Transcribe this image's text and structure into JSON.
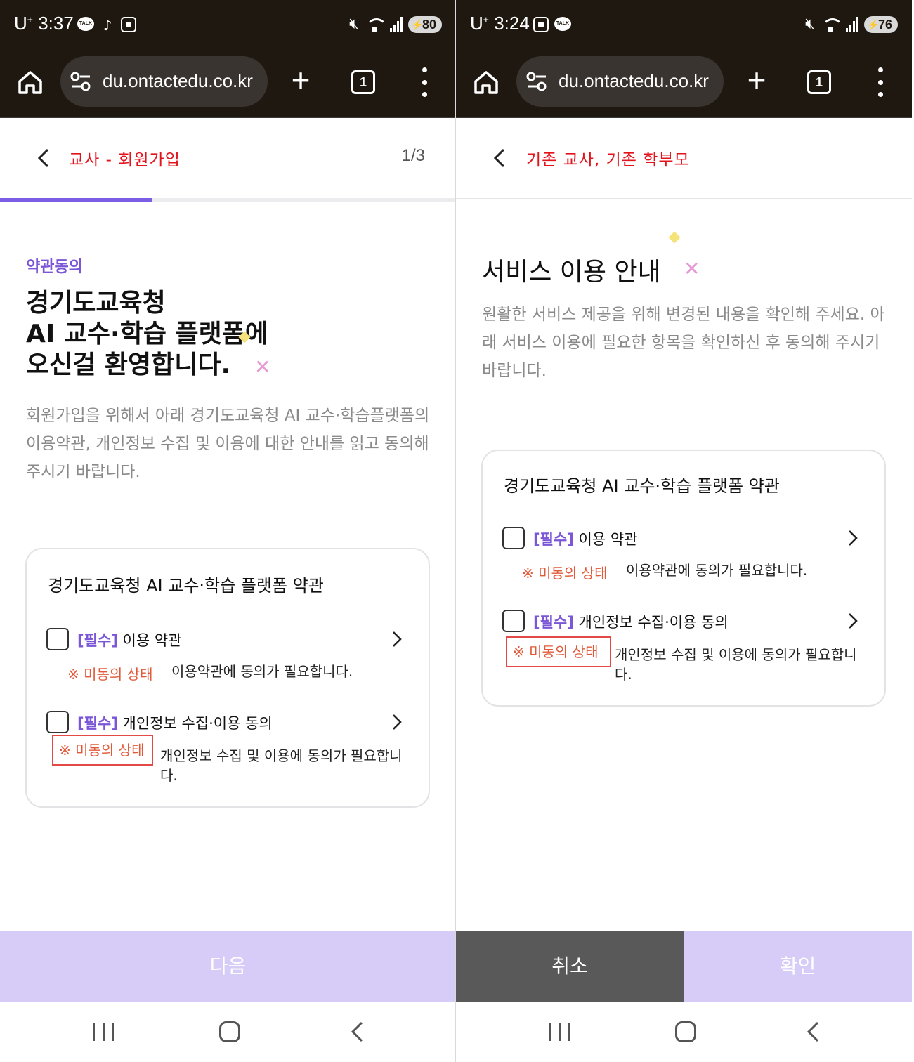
{
  "status_left": {
    "carrier": "U",
    "carrier_sup": "+",
    "time": "3:37",
    "battery": "80"
  },
  "status_right": {
    "carrier": "U",
    "carrier_sup": "+",
    "time": "3:24",
    "battery": "76"
  },
  "browser": {
    "url": "du.ontactedu.co.kr",
    "tab_count": "1"
  },
  "left": {
    "header_title": "교사 - 회원가입",
    "step": "1/3",
    "progress": 0.333,
    "eyebrow": "약관동의",
    "headline_line1": "경기도교육청",
    "headline_line2": "AI 교수·학습 플랫폼에",
    "headline_line3_a": "오신걸 ",
    "headline_line3_b": "환영합니다.",
    "description": "회원가입을 위해서 아래 경기도교육청 AI 교수·학습플랫폼의 이용약관, 개인정보 수집 및 이용에 대한 안내를 읽고 동의해 주시기 바랍니다.",
    "next_button": "다음"
  },
  "right": {
    "header_title": "기존 교사, 기존 학부모",
    "title": "서비스 이용 안내",
    "description": "원활한 서비스 제공을 위해 변경된 내용을 확인해 주세요. 아래 서비스 이용에 필요한 항목을 확인하신 후 동의해 주시기 바랍니다.",
    "cancel_button": "취소",
    "confirm_button": "확인"
  },
  "terms": {
    "card_title": "경기도교육청 AI 교수·학습 플랫폼 약관",
    "items": [
      {
        "required_tag": "[필수]",
        "label": " 이용 약관",
        "status": "※ 미동의 상태",
        "status_desc": "이용약관에 동의가 필요합니다.",
        "checked": false
      },
      {
        "required_tag": "[필수]",
        "label": " 개인정보 수집·이용 동의",
        "status": "※ 미동의 상태",
        "status_desc": "개인정보 수집 및 이용에 동의가 필요합니다.",
        "checked": false
      }
    ]
  },
  "colors": {
    "accent_purple": "#7b56d6",
    "header_red": "#e3131c",
    "notice_orange": "#e05a3a",
    "button_disabled": "#d7ccf8",
    "button_cancel": "#595959"
  },
  "icons": [
    "home-icon",
    "tune-icon",
    "plus-icon",
    "tabs-icon",
    "more-vert-icon",
    "back-chevron-icon",
    "chevron-right-icon",
    "recents-icon",
    "nav-home-icon",
    "nav-back-icon"
  ]
}
